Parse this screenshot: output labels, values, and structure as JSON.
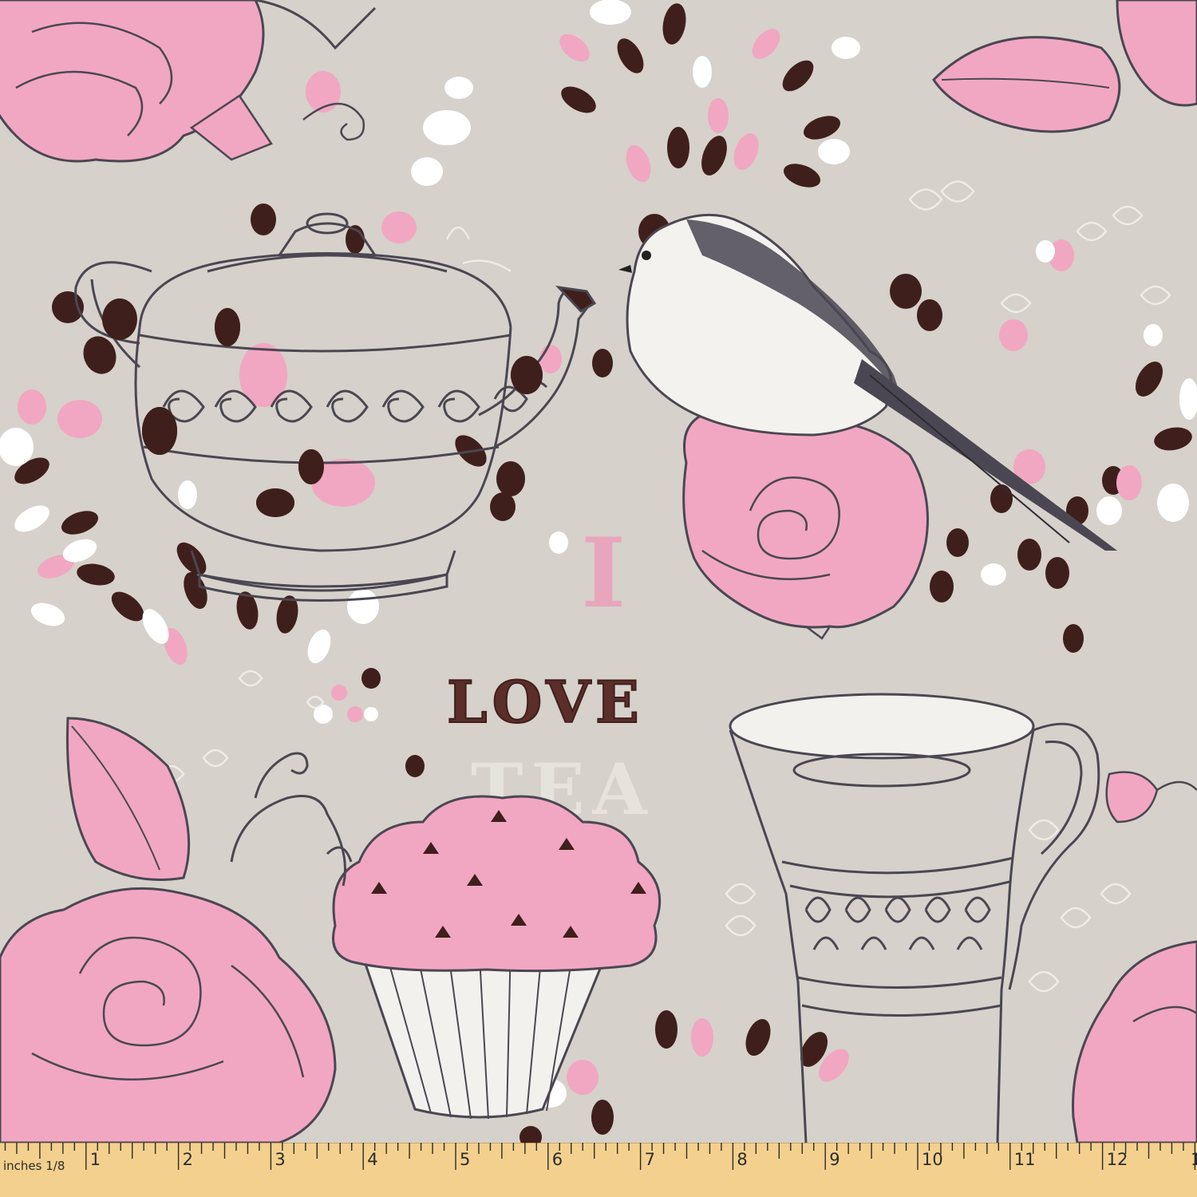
{
  "fabric": {
    "text_love": "LOVE",
    "text_tea": "TEA",
    "text_i": "I",
    "colors": {
      "background": "#d6d1ca",
      "pink": "#f1a7c1",
      "dark_brown": "#3f1f1c",
      "sketch_line": "#4a4752",
      "white": "#ffffff",
      "faint_text": "#e6e2dc",
      "letter_pink": "#ec9fba"
    }
  },
  "ruler": {
    "unit_label": "inches 1/8",
    "numbers": [
      "1",
      "2",
      "3",
      "4",
      "5",
      "6",
      "7",
      "8",
      "9",
      "10",
      "11",
      "12",
      "1"
    ],
    "color": "#f3d08d"
  }
}
